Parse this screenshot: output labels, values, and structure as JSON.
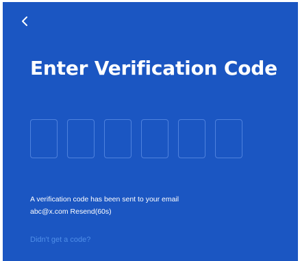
{
  "header": {
    "back_icon": "chevron-left-icon",
    "title": "Enter Verification Code"
  },
  "code_input": {
    "box_count": 6,
    "values": [
      "",
      "",
      "",
      "",
      "",
      ""
    ]
  },
  "info": {
    "message": "A verification code has been sent to your email",
    "email": "abc@x.com",
    "resend_label": "Resend(60s)"
  },
  "links": {
    "no_code": "Didn't get a code?"
  },
  "colors": {
    "background": "#1b56c2",
    "box_border": "#4f82de",
    "link": "#4f8ee8",
    "text": "#ffffff"
  }
}
